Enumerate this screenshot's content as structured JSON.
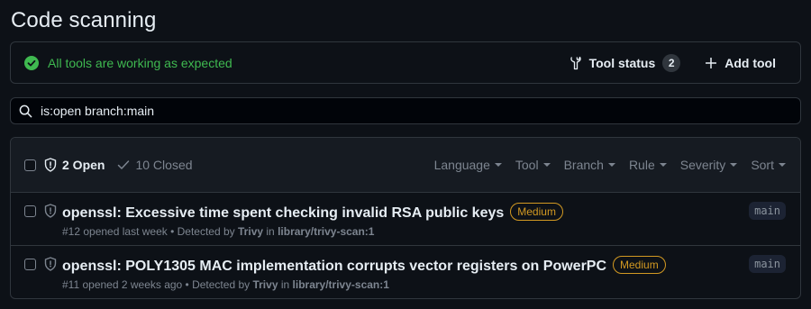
{
  "page": {
    "title": "Code scanning"
  },
  "status": {
    "message": "All tools are working as expected",
    "tool_status_label": "Tool status",
    "tool_count": "2",
    "add_tool_label": "Add tool"
  },
  "search": {
    "value": "is:open branch:main"
  },
  "tabs": {
    "open": "2 Open",
    "closed": "10 Closed"
  },
  "filters": [
    "Language",
    "Tool",
    "Branch",
    "Rule",
    "Severity",
    "Sort"
  ],
  "alerts": [
    {
      "title": "openssl: Excessive time spent checking invalid RSA public keys",
      "severity": "Medium",
      "meta_prefix": "#12 opened last week • Detected by",
      "tool": "Trivy",
      "in_label": "in",
      "location": "library/trivy-scan:1",
      "branch": "main"
    },
    {
      "title": "openssl: POLY1305 MAC implementation corrupts vector registers on PowerPC",
      "severity": "Medium",
      "meta_prefix": "#11 opened 2 weeks ago • Detected by",
      "tool": "Trivy",
      "in_label": "in",
      "location": "library/trivy-scan:1",
      "branch": "main"
    }
  ],
  "colors": {
    "success": "#3fb950",
    "attention": "#d29922",
    "background": "#0d1117",
    "border": "#30363d"
  },
  "icons": [
    "check-circle-icon",
    "tools-icon",
    "plus-icon",
    "search-icon",
    "shield-icon",
    "check-icon",
    "caret-down-icon"
  ]
}
